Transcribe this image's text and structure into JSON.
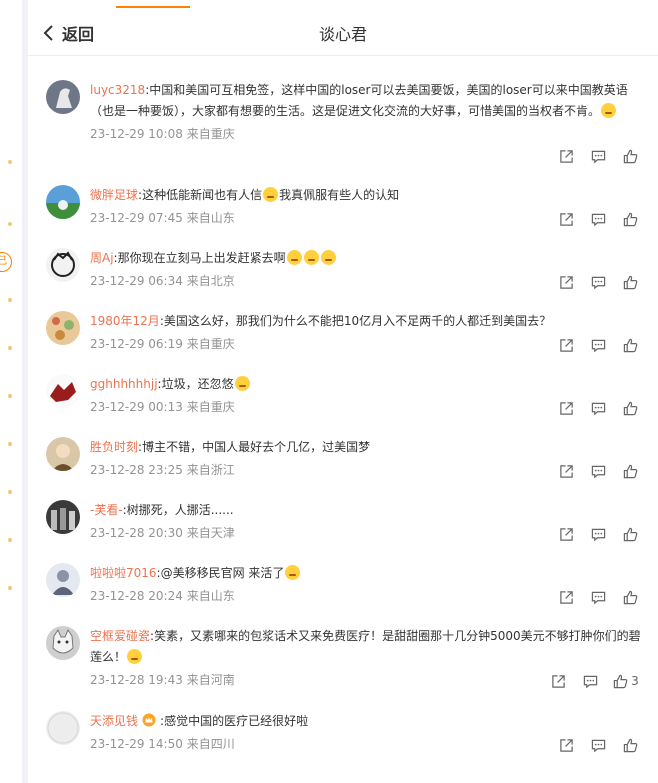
{
  "header": {
    "back_label": "返回",
    "title": "谈心君"
  },
  "comments": [
    {
      "user": "luyc3218",
      "text": "中国和美国可互相免签，这样中国的loser可以去美国要饭，美国的loser可以来中国教英语（也是一种要饭），大家都有想要的生活。这是促进文化交流的大好事，可惜美国的当权者不肯。",
      "emojis": 1,
      "time": "23-12-29 10:08",
      "location": "来自重庆"
    },
    {
      "user": "微胖足球",
      "text_a": "这种低能新闻也有人信",
      "text_b": "我真佩服有些人的认知",
      "time": "23-12-29 07:45",
      "location": "来自山东"
    },
    {
      "user": "周Aj",
      "text": "那你现在立刻马上出发赶紧去啊",
      "emojis": 3,
      "time": "23-12-29 06:34",
      "location": "来自北京"
    },
    {
      "user": "1980年12月",
      "text": "美国这么好，那我们为什么不能把10亿月入不足两千的人都迁到美国去？",
      "time": "23-12-29 06:19",
      "location": "来自重庆"
    },
    {
      "user": "gghhhhhhjj",
      "text": "垃圾，还忽悠",
      "emojis": 1,
      "time": "23-12-29 00:13",
      "location": "来自重庆"
    },
    {
      "user": "胜负时刻",
      "text": "博主不错，中国人最好去个几亿，过美国梦",
      "time": "23-12-28 23:25",
      "location": "来自浙江"
    },
    {
      "user": "-芙看-",
      "text": "树挪死，人挪活......",
      "time": "23-12-28 20:30",
      "location": "来自天津"
    },
    {
      "user": "啦啦啦7016",
      "text": "@美移移民官网 来活了",
      "emojis": 1,
      "time": "23-12-28 20:24",
      "location": "来自山东"
    },
    {
      "user": "空框爱碰瓷",
      "text": "笑素，又素哪来的包浆话术又来免费医疗！是甜甜圈那十几分钟5000美元不够打肿你们的碧莲么！",
      "emojis": 1,
      "time": "23-12-28 19:43",
      "location": "来自河南",
      "likes": "3"
    },
    {
      "user": "天添见钱",
      "text": "感觉中国的医疗已经很好啦",
      "time": "23-12-29 14:50",
      "location": "来自四川"
    }
  ],
  "icon_names": [
    "chevron-left-icon",
    "share-icon",
    "comment-icon",
    "like-icon"
  ],
  "colors": {
    "accent": "#ff8200",
    "username": "#eb7350",
    "meta": "#939393",
    "icon": "#666666"
  }
}
